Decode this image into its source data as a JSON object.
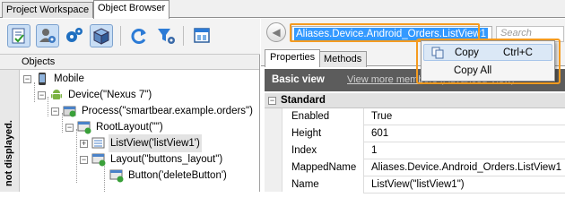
{
  "tabs": [
    {
      "label": "Project Workspace",
      "active": false
    },
    {
      "label": "Object Browser",
      "active": true
    }
  ],
  "toolbar_icons": [
    "checklist-icon",
    "user-settings-icon",
    "gears-icon",
    "display-box-icon",
    "refresh-icon",
    "filter-settings-icon",
    "window-layout-icon"
  ],
  "objects": {
    "header": "Objects",
    "side_label": "not displayed.",
    "tree": [
      {
        "label": "Mobile",
        "icon": "mobile-icon"
      },
      {
        "label": "Device(\"Nexus 7\")",
        "icon": "android-icon"
      },
      {
        "label": "Process(\"smartbear.example.orders\")",
        "icon": "process-icon"
      },
      {
        "label": "RootLayout(\"\")",
        "icon": "layout-icon"
      },
      {
        "label": "ListView('listView1')",
        "icon": "listview-icon",
        "selected": true
      },
      {
        "label": "Layout(\"buttons_layout\")",
        "icon": "layout-icon"
      },
      {
        "label": "Button('deleteButton')",
        "icon": "button-icon"
      }
    ]
  },
  "navigation": {
    "path": "Aliases.Device.Android_Orders.ListView1",
    "search_placeholder": "Search"
  },
  "properties_tabs": [
    "Properties",
    "Methods"
  ],
  "basic_view": {
    "title": "Basic view",
    "link": "View more members (Advanced View)"
  },
  "grid": {
    "section": "Standard",
    "rows": [
      {
        "name": "Enabled",
        "value": "True"
      },
      {
        "name": "Height",
        "value": "601"
      },
      {
        "name": "Index",
        "value": "1"
      },
      {
        "name": "MappedName",
        "value": "Aliases.Device.Android_Orders.ListView1"
      },
      {
        "name": "Name",
        "value": "ListView(\"listView1\")"
      }
    ]
  },
  "context_menu": {
    "items": [
      {
        "label": "Copy",
        "shortcut": "Ctrl+C"
      },
      {
        "label": "Copy All",
        "shortcut": ""
      }
    ]
  },
  "colors": {
    "highlight": "#f59b1f",
    "selection": "#3399ff",
    "header_dark": "#5c5c5c"
  }
}
